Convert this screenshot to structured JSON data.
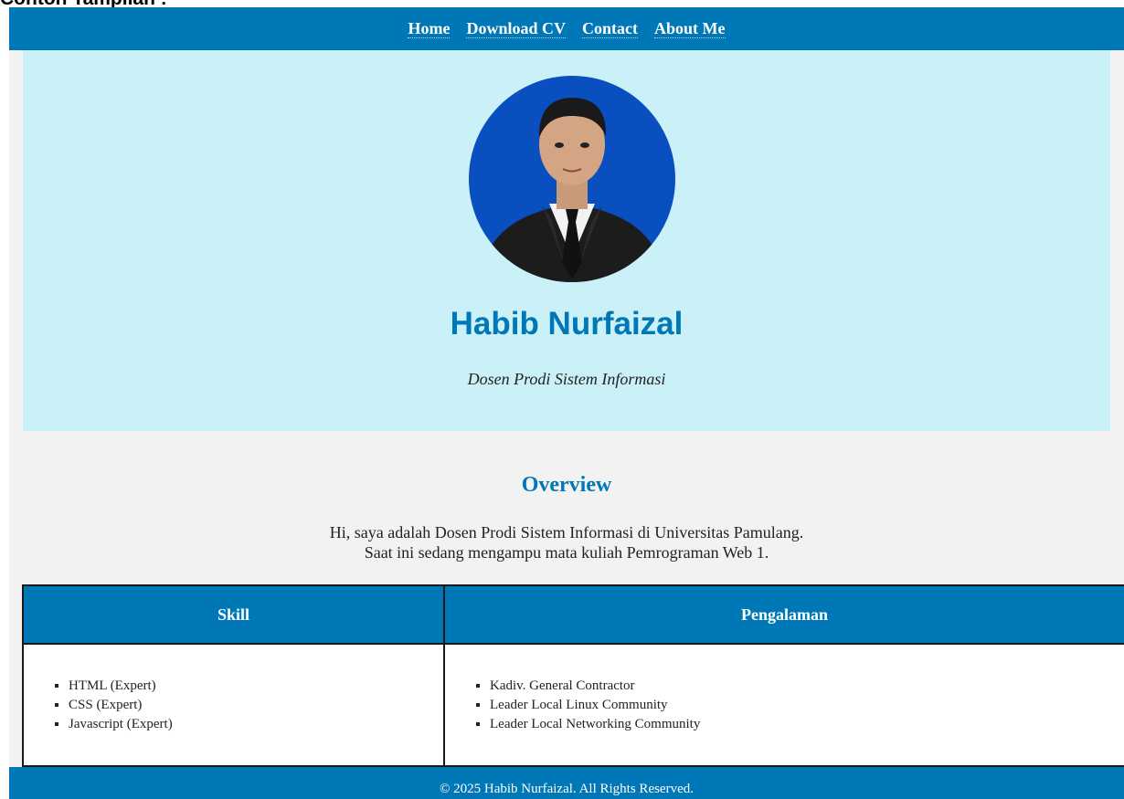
{
  "page_caption": "Contoh Tampilan :",
  "nav": {
    "items": [
      "Home",
      "Download CV",
      "Contact",
      "About Me"
    ]
  },
  "hero": {
    "name": "Habib Nurfaizal",
    "role": "Dosen Prodi Sistem Informasi"
  },
  "overview": {
    "title": "Overview",
    "line1": "Hi, saya adalah Dosen Prodi Sistem Informasi di Universitas Pamulang.",
    "line2": "Saat ini sedang mengampu mata kuliah Pemrograman Web 1."
  },
  "table": {
    "headers": [
      "Skill",
      "Pengalaman"
    ],
    "skills": [
      "HTML (Expert)",
      "CSS (Expert)",
      "Javascript (Expert)"
    ],
    "experience": [
      "Kadiv. General Contractor",
      "Leader Local Linux Community",
      "Leader Local Networking Community"
    ]
  },
  "footer": {
    "text": "© 2025 Habib Nurfaizal. All Rights Reserved."
  },
  "colors": {
    "primary": "#0077b6",
    "hero_bg": "#caf0f8",
    "page_bg": "#f2f2f2"
  }
}
